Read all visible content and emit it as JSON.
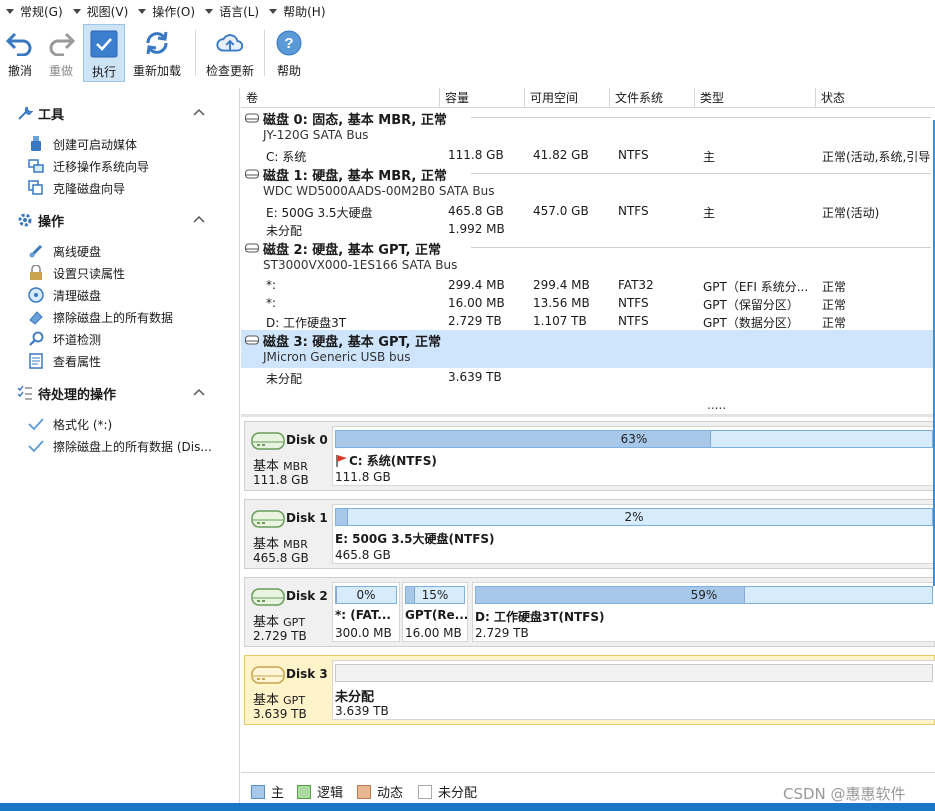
{
  "menu": [
    {
      "label": "常规(G)"
    },
    {
      "label": "视图(V)"
    },
    {
      "label": "操作(O)"
    },
    {
      "label": "语言(L)"
    },
    {
      "label": "帮助(H)"
    }
  ],
  "toolbar": {
    "undo": "撤消",
    "redo": "重做",
    "apply": "执行",
    "reload": "重新加载",
    "update": "检查更新",
    "help": "帮助"
  },
  "sidebar": {
    "tools": {
      "title": "工具",
      "items": [
        "创建可启动媒体",
        "迁移操作系统向导",
        "克隆磁盘向导"
      ]
    },
    "operations": {
      "title": "操作",
      "items": [
        "离线硬盘",
        "设置只读属性",
        "清理磁盘",
        "擦除磁盘上的所有数据",
        "坏道检测",
        "查看属性"
      ]
    },
    "pending": {
      "title": "待处理的操作",
      "items": [
        "格式化 (*:)",
        "擦除磁盘上的所有数据 (Dis..."
      ]
    }
  },
  "table": {
    "columns": [
      "卷",
      "容量",
      "可用空间",
      "文件系统",
      "类型",
      "状态"
    ],
    "disks": [
      {
        "title": "磁盘 0: 固态, 基本 MBR, 正常",
        "bus": "JY-120G SATA Bus",
        "rows": [
          {
            "volume": "C: 系统",
            "capacity": "111.8 GB",
            "free": "41.82 GB",
            "fs": "NTFS",
            "type": "主",
            "status": "正常(活动,系统,引导"
          }
        ]
      },
      {
        "title": "磁盘 1: 硬盘, 基本 MBR, 正常",
        "bus": "WDC WD5000AADS-00M2B0 SATA Bus",
        "rows": [
          {
            "volume": "E: 500G 3.5大硬盘",
            "capacity": "465.8 GB",
            "free": "457.0 GB",
            "fs": "NTFS",
            "type": "主",
            "status": "正常(活动)"
          },
          {
            "volume": "未分配",
            "capacity": "1.992 MB",
            "free": "",
            "fs": "",
            "type": "",
            "status": ""
          }
        ]
      },
      {
        "title": "磁盘 2: 硬盘, 基本 GPT, 正常",
        "bus": "ST3000VX000-1ES166 SATA Bus",
        "rows": [
          {
            "volume": "*:",
            "capacity": "299.4 MB",
            "free": "299.4 MB",
            "fs": "FAT32",
            "type": "GPT（EFI 系统分...",
            "status": "正常"
          },
          {
            "volume": "*:",
            "capacity": "16.00 MB",
            "free": "13.56 MB",
            "fs": "NTFS",
            "type": "GPT（保留分区）",
            "status": "正常"
          },
          {
            "volume": "D: 工作硬盘3T",
            "capacity": "2.729 TB",
            "free": "1.107 TB",
            "fs": "NTFS",
            "type": "GPT（数据分区）",
            "status": "正常"
          }
        ]
      },
      {
        "title": "磁盘 3: 硬盘, 基本 GPT, 正常",
        "bus": "JMicron Generic USB bus",
        "rows": [
          {
            "volume": "未分配",
            "capacity": "3.639 TB",
            "free": "",
            "fs": "",
            "type": "",
            "status": ""
          }
        ]
      }
    ],
    "more": "....."
  },
  "map": [
    {
      "name": "Disk 0",
      "type": "基本",
      "scheme": "MBR",
      "size": "111.8 GB",
      "partitions": [
        {
          "label": "C: 系统(NTFS)",
          "size": "111.8 GB",
          "percent": "63%",
          "used_fraction": 0.63,
          "flag": true
        }
      ]
    },
    {
      "name": "Disk 1",
      "type": "基本",
      "scheme": "MBR",
      "size": "465.8 GB",
      "partitions": [
        {
          "label": "E: 500G 3.5大硬盘(NTFS)",
          "size": "465.8 GB",
          "percent": "2%",
          "used_fraction": 0.02
        }
      ]
    },
    {
      "name": "Disk 2",
      "type": "基本",
      "scheme": "GPT",
      "size": "2.729 TB",
      "partitions": [
        {
          "label": "*: (FAT...",
          "size": "300.0 MB",
          "percent": "0%",
          "used_fraction": 0.0
        },
        {
          "label": "GPT(Re...",
          "size": "16.00 MB",
          "percent": "15%",
          "used_fraction": 0.15
        },
        {
          "label": "D: 工作硬盘3T(NTFS)",
          "size": "2.729 TB",
          "percent": "59%",
          "used_fraction": 0.59
        }
      ]
    },
    {
      "name": "Disk 3",
      "type": "基本",
      "scheme": "GPT",
      "size": "3.639 TB",
      "partitions": [
        {
          "label": "未分配",
          "size": "3.639 TB",
          "percent": "",
          "used_fraction": 0.0
        }
      ]
    }
  ],
  "legend": [
    "主",
    "逻辑",
    "动态",
    "未分配"
  ],
  "colors": {
    "primary": "#a8c8ea",
    "logical": "#a9dc9e",
    "dynamic": "#e8b894",
    "unallocated": "#ffffff",
    "selected_row": "#cfe5fb",
    "selected_disk": "#fff3c9"
  },
  "watermark": "CSDN @惠惠软件"
}
